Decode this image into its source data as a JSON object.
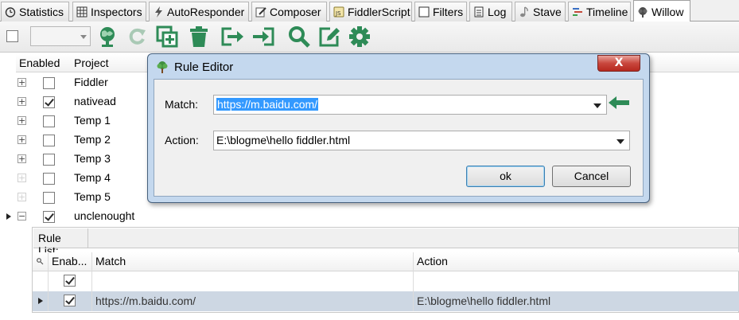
{
  "tabs": [
    {
      "label": "Statistics",
      "icon": "stopwatch-icon"
    },
    {
      "label": "Inspectors",
      "icon": "grid-icon"
    },
    {
      "label": "AutoResponder",
      "icon": "lightning-icon"
    },
    {
      "label": "Composer",
      "icon": "pencil-icon"
    },
    {
      "label": "FiddlerScript",
      "icon": "script-icon"
    },
    {
      "label": "Filters",
      "icon": "checkbox-icon"
    },
    {
      "label": "Log",
      "icon": "document-icon"
    },
    {
      "label": "Stave",
      "icon": "music-note-icon"
    },
    {
      "label": "Timeline",
      "icon": "timeline-icon"
    },
    {
      "label": "Willow",
      "icon": "willow-tree-icon",
      "active": true
    }
  ],
  "toolbar": {
    "icons": [
      "globe-icon",
      "refresh-icon",
      "duplicate-icon",
      "trash-icon",
      "export-icon",
      "import-icon",
      "search-icon",
      "edit-icon",
      "gear-icon"
    ]
  },
  "grid": {
    "col_enabled": "Enabled",
    "col_project": "Project",
    "projects": [
      {
        "name": "Fiddler",
        "enabled": false,
        "expander": "+"
      },
      {
        "name": "nativead",
        "enabled": true,
        "expander": "+"
      },
      {
        "name": "Temp 1",
        "enabled": false,
        "expander": "+"
      },
      {
        "name": "Temp 2",
        "enabled": false,
        "expander": "+"
      },
      {
        "name": "Temp 3",
        "enabled": false,
        "expander": "+"
      },
      {
        "name": "Temp 4",
        "enabled": false,
        "expander": "+"
      },
      {
        "name": "Temp 5",
        "enabled": false,
        "expander": "+"
      },
      {
        "name": "unclenought",
        "enabled": true,
        "expander": "−"
      }
    ]
  },
  "rule_list": {
    "title": "Rule List:",
    "col_enabled": "Enab...",
    "col_match": "Match",
    "col_action": "Action",
    "rows": [
      {
        "enabled": true,
        "match": "",
        "action": ""
      },
      {
        "enabled": true,
        "match": "https://m.baidu.com/",
        "action": "E:\\blogme\\hello fiddler.html"
      }
    ]
  },
  "dialog": {
    "title": "Rule Editor",
    "close_label": "X",
    "match_label": "Match:",
    "match_value": "https://m.baidu.com/",
    "action_label": "Action:",
    "action_value": "E:\\blogme\\hello fiddler.html",
    "ok_label": "ok",
    "cancel_label": "Cancel"
  },
  "colors": {
    "accent_green": "#2e8b57",
    "dialog_frame": "#c4d8ee",
    "selection": "#3399ff",
    "selected_row": "#cdd7e3"
  }
}
